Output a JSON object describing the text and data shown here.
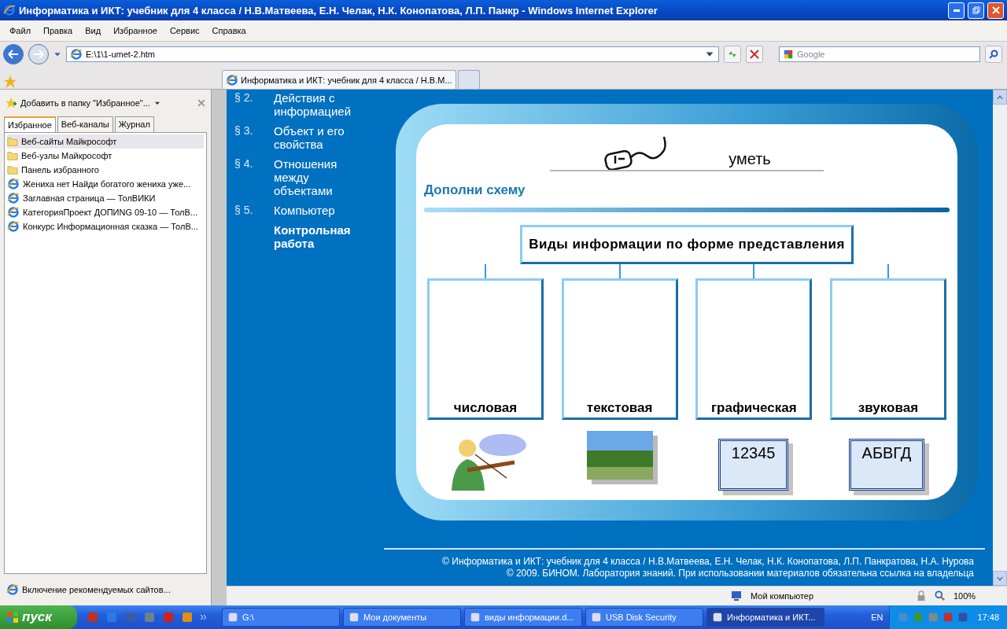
{
  "window": {
    "title": "Информатика и ИКТ: учебник для 4 класса / Н.В.Матвеева, Е.Н. Челак, Н.К. Конопатова, Л.П. Панкр - Windows Internet Explorer"
  },
  "menu": [
    "Файл",
    "Правка",
    "Вид",
    "Избранное",
    "Сервис",
    "Справка"
  ],
  "address": {
    "value": "E:\\1\\1-umet-2.htm"
  },
  "search": {
    "placeholder": "Google"
  },
  "tabs": [
    {
      "label": "Информатика и ИКТ: учебник для 4 класса / Н.В.М...",
      "selected": true
    }
  ],
  "favorites_panel": {
    "add_label": "Добавить в папку \"Избранное\"...",
    "tabs": [
      {
        "label": "Избранное",
        "selected": true
      },
      {
        "label": "Веб-каналы",
        "selected": false
      },
      {
        "label": "Журнал",
        "selected": false
      }
    ],
    "items": [
      {
        "label": "Веб-сайты Майкрософт",
        "kind": "folder",
        "selected": true
      },
      {
        "label": "Веб-узлы Майкрософт",
        "kind": "folder",
        "selected": false
      },
      {
        "label": "Панель избранного",
        "kind": "folder",
        "selected": false
      },
      {
        "label": "Жениха нет  Найди богатого жениха уже...",
        "kind": "page",
        "selected": false
      },
      {
        "label": "Заглавная страница — ТолВИКИ",
        "kind": "page",
        "selected": false
      },
      {
        "label": "КатегорияПроект ДОПИNG 09-10 — ТолВ...",
        "kind": "page",
        "selected": false
      },
      {
        "label": "Конкурс Информационная сказка — ТолВ...",
        "kind": "page",
        "selected": false
      }
    ],
    "footer": "Включение рекомендуемых сайтов..."
  },
  "page": {
    "nav": [
      {
        "number": "§ 2.",
        "label": "Действия с информацией",
        "kind": "section"
      },
      {
        "number": "§ 3.",
        "label": "Объект и его свойства",
        "kind": "section"
      },
      {
        "number": "§ 4.",
        "label": "Отношения между объектами",
        "kind": "section"
      },
      {
        "number": "§ 5.",
        "label": "Компьютер",
        "kind": "section"
      },
      {
        "label": "Контрольная работа",
        "kind": "test"
      }
    ],
    "banner": "уметь",
    "heading": "Дополни схему",
    "root": "Виды информации по форме представления",
    "branches": [
      "числовая",
      "текстовая",
      "графическая",
      "звуковая"
    ],
    "examples": [
      {
        "kind": "drawing"
      },
      {
        "kind": "photo"
      },
      {
        "kind": "card",
        "text": "12345"
      },
      {
        "kind": "card",
        "text": "АБВГД"
      }
    ],
    "footer": [
      "© Информатика и ИКТ: учебник для 4 класса / Н.В.Матвеева, Е.Н. Челак, Н.К. Конопатова, Л.П. Панкратова, Н.А. Нурова",
      "© 2009. БИНОМ. Лаборатория знаний. При использовании материалов обязательна ссылка на владельца"
    ]
  },
  "status_bar": {
    "zone": "Мой компьютер",
    "zoom": "100%"
  },
  "taskbar": {
    "start": "пуск",
    "tasks": [
      {
        "label": "G:\\",
        "selected": false
      },
      {
        "label": "Мои документы",
        "selected": false
      },
      {
        "label": "виды информации.d...",
        "selected": false
      },
      {
        "label": "USB Disk Security",
        "selected": false
      },
      {
        "label": "Информатика и ИКТ...",
        "selected": true
      }
    ],
    "language": "EN",
    "clock": "17:48"
  }
}
